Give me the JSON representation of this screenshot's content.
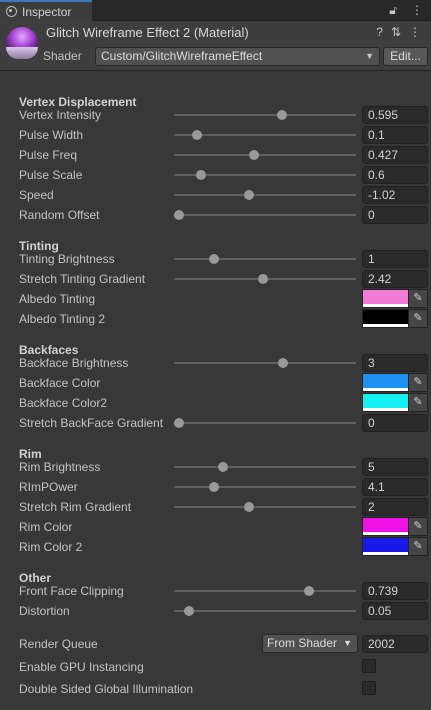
{
  "tab": {
    "title": "Inspector",
    "icon": "inspector-icon",
    "lock_icon": "lock-icon",
    "menu_icon": "kebab-menu-icon"
  },
  "header": {
    "title": "Glitch Wireframe Effect 2 (Material)",
    "shader_label": "Shader",
    "shader_value": "Custom/GlitchWireframeEffect",
    "edit_label": "Edit..."
  },
  "sections": {
    "vertex": "Vertex Displacement",
    "tinting": "Tinting",
    "backfaces": "Backfaces",
    "rim": "Rim",
    "other": "Other"
  },
  "props": {
    "vertex_intensity": {
      "label": "Vertex Intensity",
      "value": "0.595",
      "slider": 0.595
    },
    "pulse_width": {
      "label": "Pulse Width",
      "value": "0.1",
      "slider": 0.125
    },
    "pulse_freq": {
      "label": "Pulse Freq",
      "value": "0.427",
      "slider": 0.44
    },
    "pulse_scale": {
      "label": "Pulse Scale",
      "value": "0.6",
      "slider": 0.15
    },
    "speed": {
      "label": "Speed",
      "value": "-1.02",
      "slider": 0.41
    },
    "random_offset": {
      "label": "Random Offset",
      "value": "0",
      "slider": 0.03
    },
    "tinting_brightness": {
      "label": "Tinting Brightness",
      "value": "1",
      "slider": 0.22
    },
    "stretch_tinting": {
      "label": "Stretch Tinting Gradient",
      "value": "2.42",
      "slider": 0.49
    },
    "albedo_tinting": {
      "label": "Albedo Tinting",
      "color": "#f27bd6"
    },
    "albedo_tinting2": {
      "label": "Albedo Tinting 2",
      "color": "#000000"
    },
    "backface_brightness": {
      "label": "Backface Brightness",
      "value": "3",
      "slider": 0.6
    },
    "backface_color": {
      "label": "Backface Color",
      "color": "#1e90f2"
    },
    "backface_color2": {
      "label": "Backface Color2",
      "color": "#15f0f2"
    },
    "stretch_backface": {
      "label": "Stretch BackFace Gradient",
      "value": "0",
      "slider": 0.03
    },
    "rim_brightness": {
      "label": "Rim Brightness",
      "value": "5",
      "slider": 0.27
    },
    "rim_power": {
      "label": "RImPOwer",
      "value": "4.1",
      "slider": 0.22
    },
    "stretch_rim": {
      "label": "Stretch Rim Gradient",
      "value": "2",
      "slider": 0.41
    },
    "rim_color": {
      "label": "Rim Color",
      "color": "#ee12e6"
    },
    "rim_color2": {
      "label": "Rim Color 2",
      "color": "#1919e8"
    },
    "front_face_clipping": {
      "label": "Front Face Clipping",
      "value": "0.739",
      "slider": 0.74
    },
    "distortion": {
      "label": "Distortion",
      "value": "0.05",
      "slider": 0.08
    }
  },
  "render_queue": {
    "label": "Render Queue",
    "dropdown": "From Shader",
    "value": "2002"
  },
  "gpu_instancing": {
    "label": "Enable GPU Instancing",
    "checked": false
  },
  "double_sided_gi": {
    "label": "Double Sided Global Illumination",
    "checked": false
  }
}
